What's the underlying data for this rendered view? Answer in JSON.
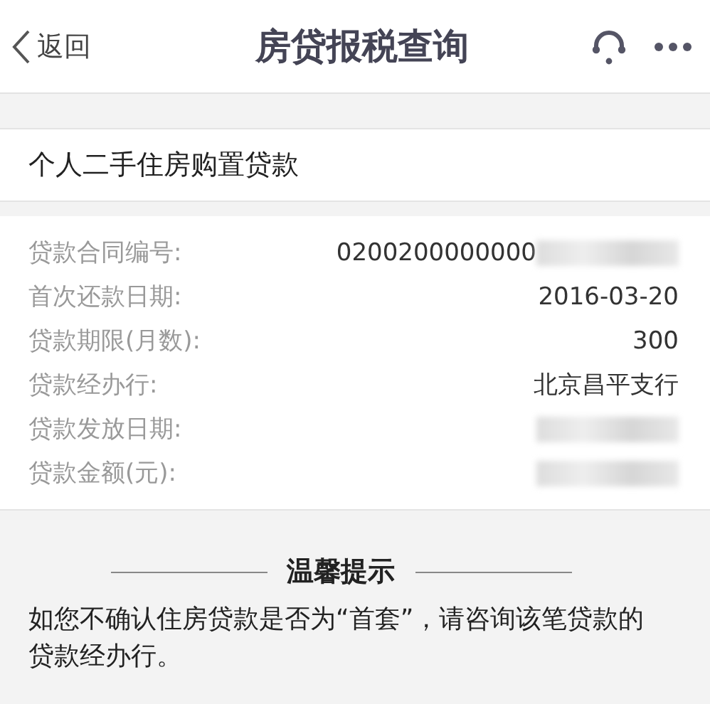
{
  "header": {
    "back_label": "返回",
    "title": "房贷报税查询"
  },
  "section_title": "个人二手住房购置贷款",
  "fields": [
    {
      "label": "贷款合同编号:",
      "value": "0200200000000",
      "redacted": true
    },
    {
      "label": "首次还款日期:",
      "value": "2016-03-20",
      "redacted": false
    },
    {
      "label": "贷款期限(月数):",
      "value": "300",
      "redacted": false
    },
    {
      "label": "贷款经办行:",
      "value": "北京昌平支行",
      "redacted": false
    },
    {
      "label": "贷款发放日期:",
      "redacted": true
    },
    {
      "label": "贷款金额(元):",
      "redacted": true
    }
  ],
  "tips": {
    "heading": "温馨提示",
    "text": "如您不确认住房贷款是否为“首套”，请咨询该笔贷款的贷款经办行。"
  }
}
